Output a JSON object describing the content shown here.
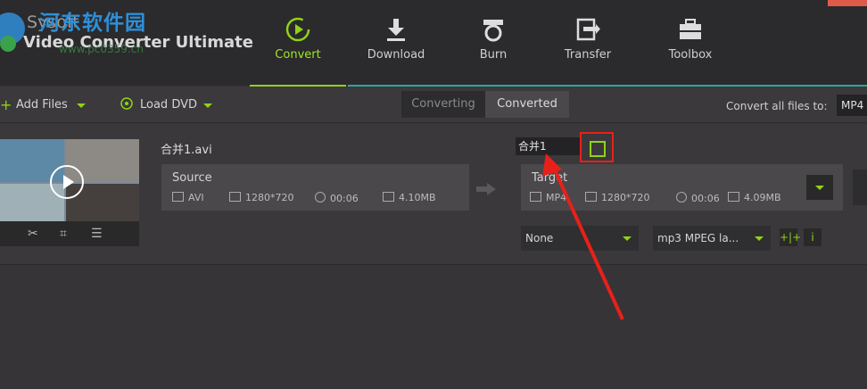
{
  "header": {
    "brand_top": "Sysoft",
    "brand_main": "Video Converter Ultimate",
    "watermark": "河东软件园",
    "watermark_url": "www.pc0359.cn",
    "nav": [
      {
        "label": "Convert",
        "icon": "convert-icon",
        "active": true
      },
      {
        "label": "Download",
        "icon": "download-icon",
        "active": false
      },
      {
        "label": "Burn",
        "icon": "burn-icon",
        "active": false
      },
      {
        "label": "Transfer",
        "icon": "transfer-icon",
        "active": false
      },
      {
        "label": "Toolbox",
        "icon": "toolbox-icon",
        "active": false
      }
    ]
  },
  "toolbar": {
    "add_files": "Add Files",
    "load_dvd": "Load DVD",
    "tab_converting": "Converting",
    "tab_converted": "Converted",
    "convert_all_label": "Convert all files to:",
    "convert_all_value": "MP4 V"
  },
  "item": {
    "filename": "合并1.avi",
    "rename_value": "合并1",
    "source": {
      "title": "Source",
      "format": "AVI",
      "resolution": "1280*720",
      "duration": "00:06",
      "size": "4.10MB"
    },
    "target": {
      "title": "Target",
      "format": "MP4",
      "resolution": "1280*720",
      "duration": "00:06",
      "size": "4.09MB"
    },
    "subtitle_select": "None",
    "audio_select": "mp3 MPEG la..."
  },
  "colors": {
    "accent_green": "#8fd414",
    "highlight_red": "#e8201a",
    "teal_line": "#2aa8a0"
  }
}
